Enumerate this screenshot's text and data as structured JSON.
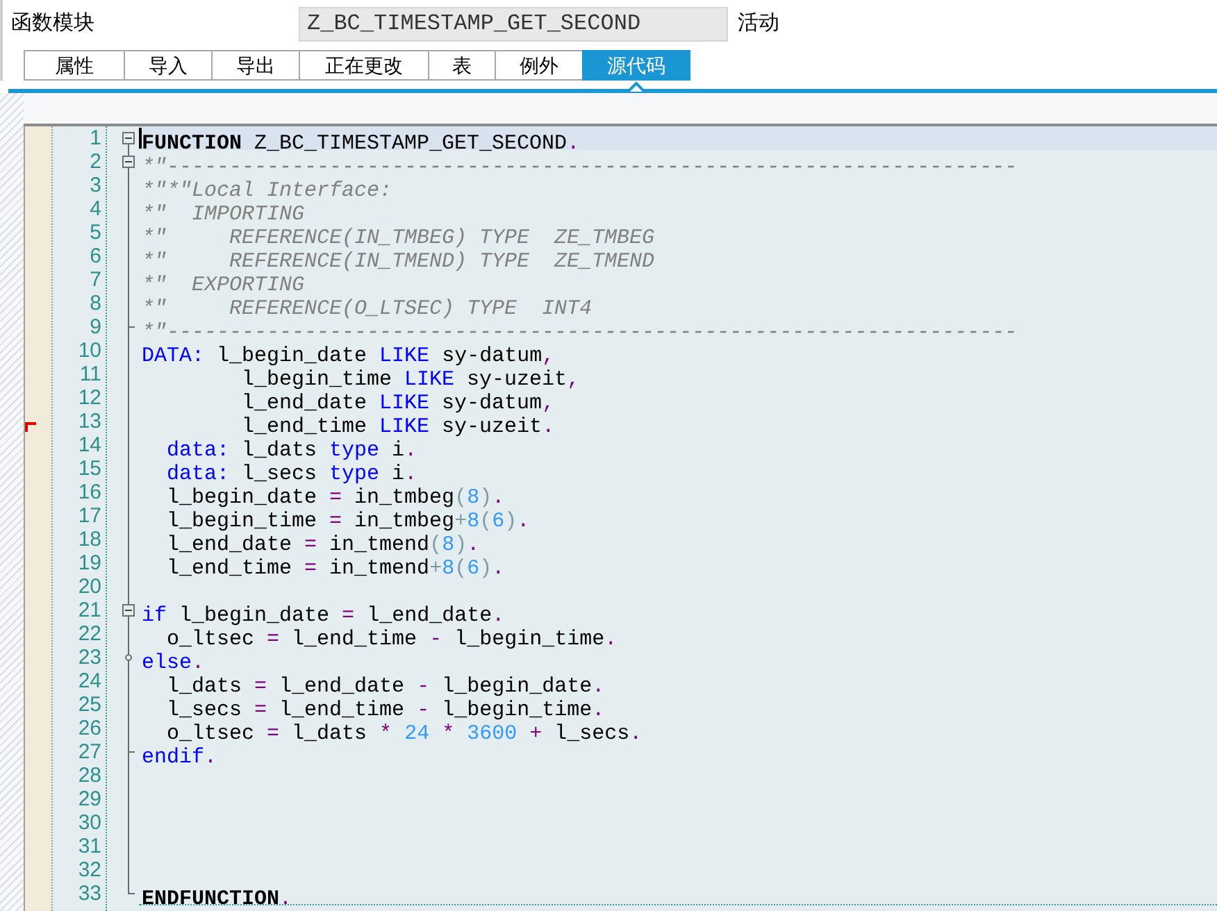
{
  "header": {
    "label": "函数模块",
    "name_field": {
      "value": "Z_BC_TIMESTAMP_GET_SECOND"
    },
    "status": "活动"
  },
  "tabs": [
    {
      "label": "属性",
      "selected": false
    },
    {
      "label": "导入",
      "selected": false
    },
    {
      "label": "导出",
      "selected": false
    },
    {
      "label": "正在更改",
      "selected": false
    },
    {
      "label": "表",
      "selected": false
    },
    {
      "label": "例外",
      "selected": false
    },
    {
      "label": "源代码",
      "selected": true
    }
  ],
  "editor": {
    "lines": [
      {
        "number": "1",
        "selected": true,
        "marked": false,
        "kind": "start",
        "tokens": [
          {
            "text": "FUNCTION",
            "kind": "statement"
          },
          {
            "text": " Z_BC_TIMESTAMP_GET_SECOND",
            "kind": "plain"
          },
          {
            "text": ".",
            "kind": "operator"
          }
        ]
      },
      {
        "number": "2",
        "selected": false,
        "marked": false,
        "kind": "start",
        "tokens": [
          {
            "text": "*\"--------------------------------------------------------------------",
            "kind": "comment"
          }
        ]
      },
      {
        "number": "3",
        "selected": false,
        "marked": false,
        "kind": "plain",
        "tokens": [
          {
            "text": "*\"*\"Local Interface:",
            "kind": "comment"
          }
        ]
      },
      {
        "number": "4",
        "selected": false,
        "marked": false,
        "kind": "plain",
        "tokens": [
          {
            "text": "*\"  IMPORTING",
            "kind": "comment"
          }
        ]
      },
      {
        "number": "5",
        "selected": false,
        "marked": false,
        "kind": "plain",
        "tokens": [
          {
            "text": "*\"     REFERENCE(IN_TMBEG) TYPE  ZE_TMBEG",
            "kind": "comment"
          }
        ]
      },
      {
        "number": "6",
        "selected": false,
        "marked": false,
        "kind": "plain",
        "tokens": [
          {
            "text": "*\"     REFERENCE(IN_TMEND) TYPE  ZE_TMEND",
            "kind": "comment"
          }
        ]
      },
      {
        "number": "7",
        "selected": false,
        "marked": false,
        "kind": "plain",
        "tokens": [
          {
            "text": "*\"  EXPORTING",
            "kind": "comment"
          }
        ]
      },
      {
        "number": "8",
        "selected": false,
        "marked": false,
        "kind": "plain",
        "tokens": [
          {
            "text": "*\"     REFERENCE(O_LTSEC) TYPE  INT4",
            "kind": "comment"
          }
        ]
      },
      {
        "number": "9",
        "selected": false,
        "marked": false,
        "kind": "end",
        "tokens": [
          {
            "text": "*\"--------------------------------------------------------------------",
            "kind": "comment"
          }
        ]
      },
      {
        "number": "10",
        "selected": false,
        "marked": false,
        "kind": "plain",
        "tokens": [
          {
            "text": "DATA:",
            "kind": "keyword"
          },
          {
            "text": " l_begin_date ",
            "kind": "plain"
          },
          {
            "text": "LIKE",
            "kind": "keyword"
          },
          {
            "text": " sy-datum",
            "kind": "plain"
          },
          {
            "text": ",",
            "kind": "operator"
          }
        ]
      },
      {
        "number": "11",
        "selected": false,
        "marked": false,
        "kind": "plain",
        "tokens": [
          {
            "text": "        l_begin_time ",
            "kind": "plain"
          },
          {
            "text": "LIKE",
            "kind": "keyword"
          },
          {
            "text": " sy-uzeit",
            "kind": "plain"
          },
          {
            "text": ",",
            "kind": "operator"
          }
        ]
      },
      {
        "number": "12",
        "selected": false,
        "marked": false,
        "kind": "plain",
        "tokens": [
          {
            "text": "        l_end_date ",
            "kind": "plain"
          },
          {
            "text": "LIKE",
            "kind": "keyword"
          },
          {
            "text": " sy-datum",
            "kind": "plain"
          },
          {
            "text": ",",
            "kind": "operator"
          }
        ]
      },
      {
        "number": "13",
        "selected": false,
        "marked": true,
        "kind": "plain",
        "tokens": [
          {
            "text": "        l_end_time ",
            "kind": "plain"
          },
          {
            "text": "LIKE",
            "kind": "keyword"
          },
          {
            "text": " sy-uzeit",
            "kind": "plain"
          },
          {
            "text": ".",
            "kind": "operator"
          }
        ]
      },
      {
        "number": "14",
        "selected": false,
        "marked": false,
        "kind": "plain",
        "tokens": [
          {
            "text": "  data:",
            "kind": "keyword"
          },
          {
            "text": " l_dats ",
            "kind": "plain"
          },
          {
            "text": "type",
            "kind": "keyword"
          },
          {
            "text": " i",
            "kind": "plain"
          },
          {
            "text": ".",
            "kind": "operator"
          }
        ]
      },
      {
        "number": "15",
        "selected": false,
        "marked": false,
        "kind": "plain",
        "tokens": [
          {
            "text": "  data:",
            "kind": "keyword"
          },
          {
            "text": " l_secs ",
            "kind": "plain"
          },
          {
            "text": "type",
            "kind": "keyword"
          },
          {
            "text": " i",
            "kind": "plain"
          },
          {
            "text": ".",
            "kind": "operator"
          }
        ]
      },
      {
        "number": "16",
        "selected": false,
        "marked": false,
        "kind": "plain",
        "tokens": [
          {
            "text": "  l_begin_date ",
            "kind": "plain"
          },
          {
            "text": "=",
            "kind": "operator"
          },
          {
            "text": " in_tmbeg",
            "kind": "plain"
          },
          {
            "text": "(",
            "kind": "punct"
          },
          {
            "text": "8",
            "kind": "number"
          },
          {
            "text": ")",
            "kind": "punct"
          },
          {
            "text": ".",
            "kind": "operator"
          }
        ]
      },
      {
        "number": "17",
        "selected": false,
        "marked": false,
        "kind": "plain",
        "tokens": [
          {
            "text": "  l_begin_time ",
            "kind": "plain"
          },
          {
            "text": "=",
            "kind": "operator"
          },
          {
            "text": " in_tmbeg",
            "kind": "plain"
          },
          {
            "text": "+",
            "kind": "punct"
          },
          {
            "text": "8",
            "kind": "number"
          },
          {
            "text": "(",
            "kind": "punct"
          },
          {
            "text": "6",
            "kind": "number"
          },
          {
            "text": ")",
            "kind": "punct"
          },
          {
            "text": ".",
            "kind": "operator"
          }
        ]
      },
      {
        "number": "18",
        "selected": false,
        "marked": false,
        "kind": "plain",
        "tokens": [
          {
            "text": "  l_end_date ",
            "kind": "plain"
          },
          {
            "text": "=",
            "kind": "operator"
          },
          {
            "text": " in_tmend",
            "kind": "plain"
          },
          {
            "text": "(",
            "kind": "punct"
          },
          {
            "text": "8",
            "kind": "number"
          },
          {
            "text": ")",
            "kind": "punct"
          },
          {
            "text": ".",
            "kind": "operator"
          }
        ]
      },
      {
        "number": "19",
        "selected": false,
        "marked": false,
        "kind": "plain",
        "tokens": [
          {
            "text": "  l_end_time ",
            "kind": "plain"
          },
          {
            "text": "=",
            "kind": "operator"
          },
          {
            "text": " in_tmend",
            "kind": "plain"
          },
          {
            "text": "+",
            "kind": "punct"
          },
          {
            "text": "8",
            "kind": "number"
          },
          {
            "text": "(",
            "kind": "punct"
          },
          {
            "text": "6",
            "kind": "number"
          },
          {
            "text": ")",
            "kind": "punct"
          },
          {
            "text": ".",
            "kind": "operator"
          }
        ]
      },
      {
        "number": "20",
        "selected": false,
        "marked": false,
        "kind": "plain"
      },
      {
        "number": "21",
        "selected": false,
        "marked": false,
        "kind": "start",
        "tokens": [
          {
            "text": "if",
            "kind": "keyword"
          },
          {
            "text": " l_begin_date ",
            "kind": "plain"
          },
          {
            "text": "=",
            "kind": "operator"
          },
          {
            "text": " l_end_date",
            "kind": "plain"
          },
          {
            "text": ".",
            "kind": "operator"
          }
        ]
      },
      {
        "number": "22",
        "selected": false,
        "marked": false,
        "kind": "plain",
        "tokens": [
          {
            "text": "  o_ltsec ",
            "kind": "plain"
          },
          {
            "text": "=",
            "kind": "operator"
          },
          {
            "text": " l_end_time ",
            "kind": "plain"
          },
          {
            "text": "-",
            "kind": "operator"
          },
          {
            "text": " l_begin_time",
            "kind": "plain"
          },
          {
            "text": ".",
            "kind": "operator"
          }
        ]
      },
      {
        "number": "23",
        "selected": false,
        "marked": false,
        "kind": "branch",
        "tokens": [
          {
            "text": "else",
            "kind": "keyword"
          },
          {
            "text": ".",
            "kind": "operator"
          }
        ]
      },
      {
        "number": "24",
        "selected": false,
        "marked": false,
        "kind": "plain",
        "tokens": [
          {
            "text": "  l_dats ",
            "kind": "plain"
          },
          {
            "text": "=",
            "kind": "operator"
          },
          {
            "text": " l_end_date ",
            "kind": "plain"
          },
          {
            "text": "-",
            "kind": "operator"
          },
          {
            "text": " l_begin_date",
            "kind": "plain"
          },
          {
            "text": ".",
            "kind": "operator"
          }
        ]
      },
      {
        "number": "25",
        "selected": false,
        "marked": false,
        "kind": "plain",
        "tokens": [
          {
            "text": "  l_secs ",
            "kind": "plain"
          },
          {
            "text": "=",
            "kind": "operator"
          },
          {
            "text": " l_end_time ",
            "kind": "plain"
          },
          {
            "text": "-",
            "kind": "operator"
          },
          {
            "text": " l_begin_time",
            "kind": "plain"
          },
          {
            "text": ".",
            "kind": "operator"
          }
        ]
      },
      {
        "number": "26",
        "selected": false,
        "marked": false,
        "kind": "plain",
        "tokens": [
          {
            "text": "  o_ltsec ",
            "kind": "plain"
          },
          {
            "text": "=",
            "kind": "operator"
          },
          {
            "text": " l_dats",
            "kind": "plain"
          },
          {
            "text": " *",
            "kind": "operator"
          },
          {
            "text": " 24",
            "kind": "number"
          },
          {
            "text": " *",
            "kind": "operator"
          },
          {
            "text": " 3600",
            "kind": "number"
          },
          {
            "text": " +",
            "kind": "operator"
          },
          {
            "text": " l_secs",
            "kind": "plain"
          },
          {
            "text": ".",
            "kind": "operator"
          }
        ]
      },
      {
        "number": "27",
        "selected": false,
        "marked": false,
        "kind": "end",
        "tokens": [
          {
            "text": "endif",
            "kind": "keyword"
          },
          {
            "text": ".",
            "kind": "operator"
          }
        ]
      },
      {
        "number": "28",
        "selected": false,
        "marked": false,
        "kind": "plain"
      },
      {
        "number": "29",
        "selected": false,
        "marked": false,
        "kind": "plain"
      },
      {
        "number": "30",
        "selected": false,
        "marked": false,
        "kind": "plain"
      },
      {
        "number": "31",
        "selected": false,
        "marked": false,
        "kind": "plain"
      },
      {
        "number": "32",
        "selected": false,
        "marked": false,
        "kind": "plain"
      },
      {
        "number": "33",
        "selected": false,
        "marked": false,
        "kind": "end",
        "tokens": [
          {
            "text": "ENDFUNCTION",
            "kind": "statement"
          },
          {
            "text": ".",
            "kind": "operator"
          }
        ]
      }
    ]
  }
}
